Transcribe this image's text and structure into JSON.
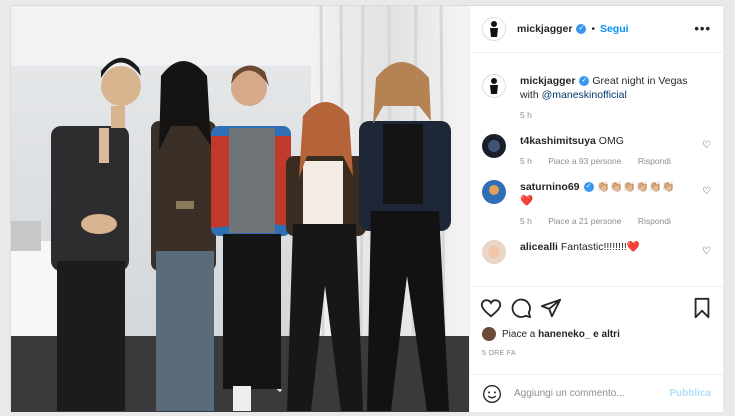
{
  "post": {
    "author": "mickjagger",
    "follow_label": "Segui",
    "dot": "•",
    "more": "•••",
    "caption_text": "Great night in Vegas with",
    "caption_mention": "@maneskinofficial",
    "caption_time": "5 h"
  },
  "comments": [
    {
      "user": "t4kashimitsuya",
      "text": "OMG",
      "time": "5 h",
      "likes": "Piace a 93 persone",
      "reply": "Rispondi"
    },
    {
      "user": "saturnino69",
      "text": "👏🏼👏🏼👏🏼👏🏼👏🏼👏🏼",
      "heart": "❤️",
      "time": "5 h",
      "likes": "Piace a 21 persone",
      "reply": "Rispondi"
    },
    {
      "user": "alicealli",
      "text": "Fantastic!!!!!!!!❤️"
    }
  ],
  "likes": {
    "prefix": "Piace a",
    "user": "haneneko_",
    "suffix": "e altri"
  },
  "time_ago": "5 ORE FA",
  "add_comment": {
    "placeholder": "Aggiungi un commento...",
    "publish": "Pubblica"
  },
  "colors": {
    "accent": "#0095f6",
    "verified": "#3897f0",
    "muted": "#8e8e8e"
  }
}
